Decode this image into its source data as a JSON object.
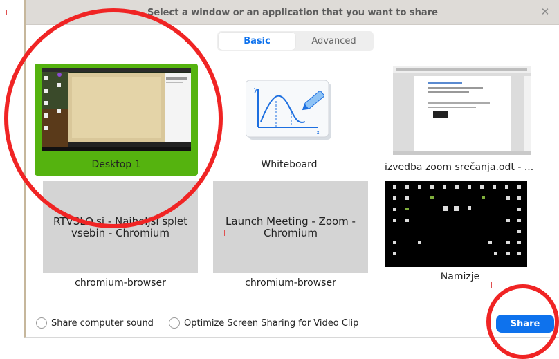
{
  "dialog": {
    "title": "Select a window or an application that you want to share"
  },
  "tabs": [
    {
      "label": "Basic",
      "active": true
    },
    {
      "label": "Advanced",
      "active": false
    }
  ],
  "tiles": {
    "desktop": {
      "label": "Desktop 1",
      "selected": true
    },
    "whiteboard": {
      "label": "Whiteboard"
    },
    "odt": {
      "label": "izvedba zoom srečanja.odt - ..."
    },
    "rtvslo": {
      "thumb_text": "RTVSLO.si - Najboljši splet vsebin - Chromium",
      "label": "chromium-browser"
    },
    "launch": {
      "thumb_text": "Launch Meeting - Zoom - Chromium",
      "label": "chromium-browser"
    },
    "namizje": {
      "label": "Namizje"
    }
  },
  "footer": {
    "share_sound": "Share computer sound",
    "optimize": "Optimize Screen Sharing for Video Clip",
    "share_button": "Share"
  },
  "colors": {
    "accent": "#0e72ed",
    "selected_tile": "#55b30f",
    "annotation": "#f02424"
  },
  "icons": {
    "close": "close-icon",
    "whiteboard": "whiteboard-icon"
  }
}
